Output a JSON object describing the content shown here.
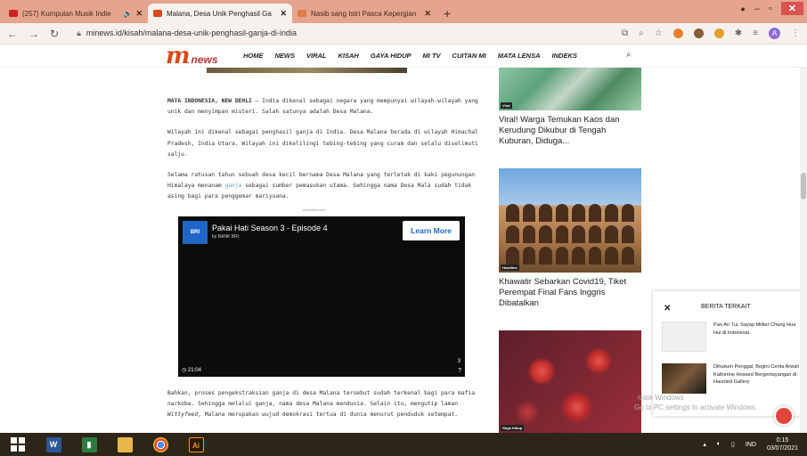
{
  "browser": {
    "tabs": [
      {
        "title": "(257) Kumpulan Musik Indie",
        "color": "#cc2222",
        "active": false
      },
      {
        "title": "Malana, Desa Unik Penghasil Ga",
        "color": "#d84a1b",
        "active": true
      },
      {
        "title": "Nasib sang Istri Pasca Kepergian",
        "color": "#e07b4a",
        "active": false
      }
    ],
    "new_tab": "+",
    "url": "minews.id/kisah/malana-desa-unik-penghasil-ganja-di-india",
    "profile_initial": "A"
  },
  "site": {
    "logo_mark": "m",
    "logo_text": "news",
    "menu": [
      "HOME",
      "NEWS",
      "VIRAL",
      "KISAH",
      "GAYA HIDUP",
      "MI TV",
      "CUITAN MI",
      "MATA LENSA",
      "INDEKS"
    ]
  },
  "article": {
    "p1_lead": "MATA INDONESIA, NEW DEHLI",
    "p1_rest": " – India dikenal sebagai negara yang mempunyai wilayah-wilayah yang unik dan menyimpan misteri. Salah satunya adalah Desa Malana.",
    "p2": "Wilayah ini dikenal sebagai penghasil ganja di India. Desa Malana  berada di wilayah Himachal Pradesh, India Utara. Wilayah ini dikelilingi tebing-tebing yang curam dan selalu diselimuti salju.",
    "p3_a": "Selama ratusan tahun sebuah desa kecil bernama Desa Malana yang terletak di kaki pegunungan Himalaya menanam ",
    "p3_link": "ganja",
    "p3_b": " sebagai sumber pemasukan utama. Sehingga nama Desa Mala sudah tidak asing bagi para penggemar mariyuana.",
    "ad_label": "advertisement",
    "p4_a": "Bahkan, proses pengekstraksian ganja di desa Malana tersebut sudah terkenal bagi para mafia narkoba. Sehingga melalui ganja, nama ",
    "p4_link": "desa Malana",
    "p4_b": " mendunia. Selain itu, mengutip laman ",
    "p4_italic": "Wittyfeed",
    "p4_c": ", Malana merupakan wujud demokrasi tertua di dunia menurut penduduk setempat."
  },
  "video": {
    "thumb_text": "BRI",
    "title": "Pakai Hati Season 3 - Episode 4",
    "subtitle": "by BANK BRI",
    "cta": "Learn More",
    "time": "21:04",
    "count": "3"
  },
  "sidebar": {
    "cards": [
      {
        "badge": "Viral",
        "title": "Viral! Warga Temukan Kaos dan Kerudung Dikubur di Tengah Kuburan, Diduga..."
      },
      {
        "badge": "Headline",
        "title": "Khawatir Sebarkan Covid19, Tiket Perempat Final Fans Inggris Dibatalkan"
      },
      {
        "badge": "Gaya Hidup",
        "title": ""
      }
    ]
  },
  "popup": {
    "close": "✕",
    "title": "BERITA TERKAIT",
    "items": [
      {
        "title": "Pao An Tui, Sayap Militer Chung Hua Hui di Indonesia"
      },
      {
        "title": "Dihukum Penggal, Begini Cerita Arwah Katherine Howard Bergentayangan di Haunted Gallery"
      }
    ]
  },
  "os": {
    "watermark_line1": "ivate Windows",
    "watermark_line2": "Go to PC settings to activate Windows.",
    "lang": "IND",
    "time": "0:15",
    "date": "03/07/2021"
  }
}
